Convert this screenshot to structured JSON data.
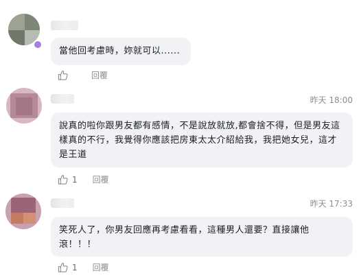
{
  "comments": [
    {
      "author": "",
      "text": "當他回考慮時，妳就可以......",
      "time": "",
      "likes": "",
      "reply_label": "回覆"
    },
    {
      "author": "",
      "text": "說真的啦你跟男友都有感情，不是說放就放,都會捨不得，但是男友這樣真的不行，我覺得你應該把房東太太介紹給我，我把她女兒，這才是王道",
      "time": "昨天 18:00",
      "likes": "1",
      "reply_label": "回覆"
    },
    {
      "author": "",
      "text": "笑死人了，你男友回應再考慮看看，這種男人還要？直接讓他滾！！！",
      "time": "昨天 17:33",
      "likes": "1",
      "reply_label": "回覆"
    }
  ],
  "colors": {
    "bubble_bg": "#f0f2f5",
    "meta_text": "#8a8d91",
    "badge": "#a77de0"
  },
  "icons": {
    "like": "thumbs-up-icon",
    "badge": "profile-badge-icon"
  }
}
